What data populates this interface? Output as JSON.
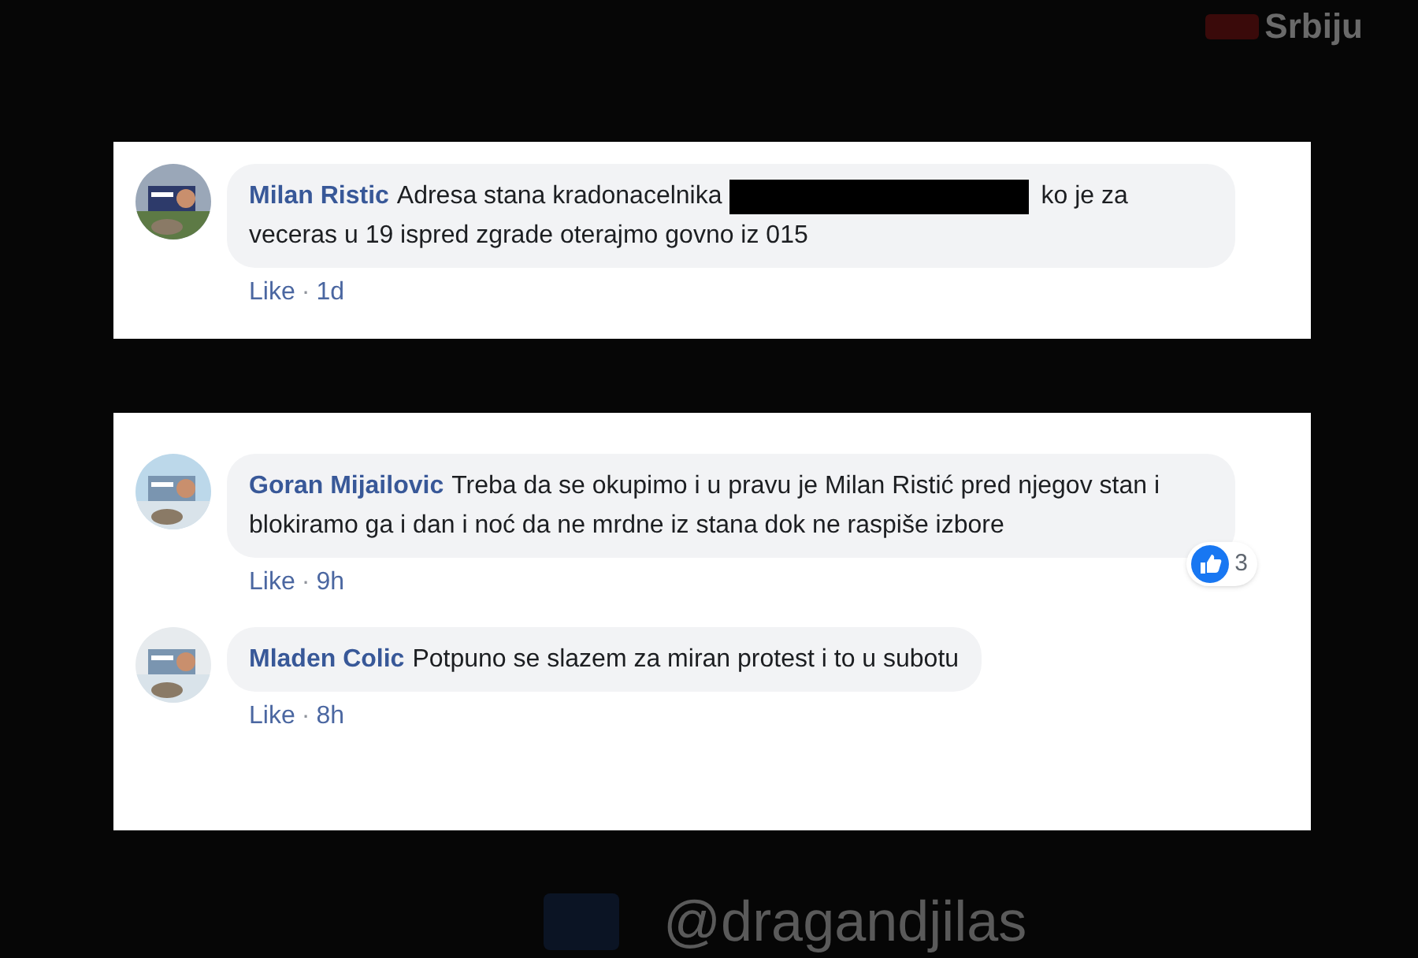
{
  "background": {
    "top_text": "Srbiju",
    "handle": "@dragandjilas"
  },
  "cards": [
    {
      "comments": [
        {
          "author": "Milan Ristic",
          "segments": [
            {
              "kind": "text",
              "text": "Adresa stana kradonacelnika"
            },
            {
              "kind": "redaction"
            },
            {
              "kind": "text",
              "text": "ko je za veceras u 19 ispred zgrade oterajmo govno iz 015"
            }
          ],
          "like": "Like",
          "separator": "·",
          "time": "1d"
        }
      ]
    },
    {
      "comments": [
        {
          "author": "Goran Mijailovic",
          "segments": [
            {
              "kind": "text",
              "text": "Treba da se okupimo i u pravu je Milan Ristić pred njegov stan i blokiramo ga i dan i noć da ne mrdne iz stana dok ne raspiše izbore"
            }
          ],
          "like": "Like",
          "separator": "·",
          "time": "9h",
          "reactions": "3"
        },
        {
          "author": "Mladen Colic",
          "segments": [
            {
              "kind": "text",
              "text": "Potpuno se slazem za miran protest i to u subotu"
            }
          ],
          "like": "Like",
          "separator": "·",
          "time": "8h"
        }
      ]
    }
  ]
}
